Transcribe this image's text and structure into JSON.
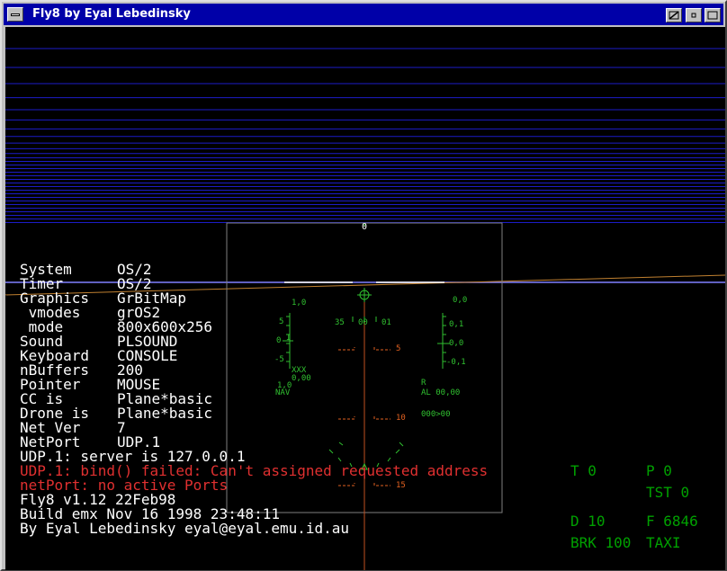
{
  "window": {
    "title": "Fly8 by Eyal Lebedinsky"
  },
  "console": {
    "lines": [
      {
        "label": "System",
        "value": "OS/2"
      },
      {
        "label": "Timer",
        "value": "OS/2"
      },
      {
        "label": "Graphics",
        "value": "GrBitMap"
      },
      {
        "label": " vmodes",
        "value": "grOS2"
      },
      {
        "label": " mode",
        "value": "800x600x256"
      },
      {
        "label": "Sound",
        "value": "PLSOUND"
      },
      {
        "label": "Keyboard",
        "value": "CONSOLE"
      },
      {
        "label": "nBuffers",
        "value": "200"
      },
      {
        "label": "Pointer",
        "value": "MOUSE"
      },
      {
        "label": "CC is",
        "value": "Plane*basic"
      },
      {
        "label": "Drone is",
        "value": "Plane*basic"
      },
      {
        "label": "Net Ver",
        "value": "7"
      },
      {
        "label": "NetPort",
        "value": "UDP.1"
      }
    ],
    "messages": [
      {
        "text": "UDP.1: server is 127.0.0.1",
        "color": "#ffffff"
      },
      {
        "text": "UDP.1: bind() failed: Can't assigned requested address",
        "color": "#e03030"
      },
      {
        "text": "netPort: no active Ports",
        "color": "#e03030"
      },
      {
        "text": "Fly8 v1.12 22Feb98",
        "color": "#ffffff"
      },
      {
        "text": "Build emx Nov 16 1998 23:48:11",
        "color": "#ffffff"
      },
      {
        "text": "By Eyal Lebedinsky eyal@eyal.emu.id.au",
        "color": "#ffffff"
      }
    ]
  },
  "status": {
    "t": "T 0",
    "p": "P 0",
    "tst": "TST 0",
    "d": "D 10",
    "f": "F 6846",
    "brk": "BRK 100",
    "taxi": "TAXI"
  },
  "hud": {
    "top_marker": "0",
    "speed_top": "1,0",
    "speed_5": "5",
    "speed_0": "0",
    "speed_m5": "-5",
    "speed_i": "I",
    "xxx": "XXX",
    "g000": "0,00",
    "nav_val": "1,0",
    "nav": "NAV",
    "heading_left": "35",
    "heading_mid": "00",
    "heading_right": "01",
    "alt_top": "0,0",
    "alt_01": "0,1",
    "alt_00": "0,0",
    "alt_m01": "-0,1",
    "r": "R",
    "al": "AL 00,00",
    "range": "000>00",
    "pitch_5": "5",
    "pitch_10": "10",
    "pitch_15": "15"
  },
  "colors": {
    "sky_lines": "#1c1cc8",
    "horizon": "#8080ff",
    "ground_line": "#c08030",
    "hud": "#30c030",
    "pitch_ladder": "#e06020",
    "console_text": "#ffffff",
    "error_text": "#e03030",
    "status_text": "#00a000",
    "titlebar": "#0000a8"
  }
}
